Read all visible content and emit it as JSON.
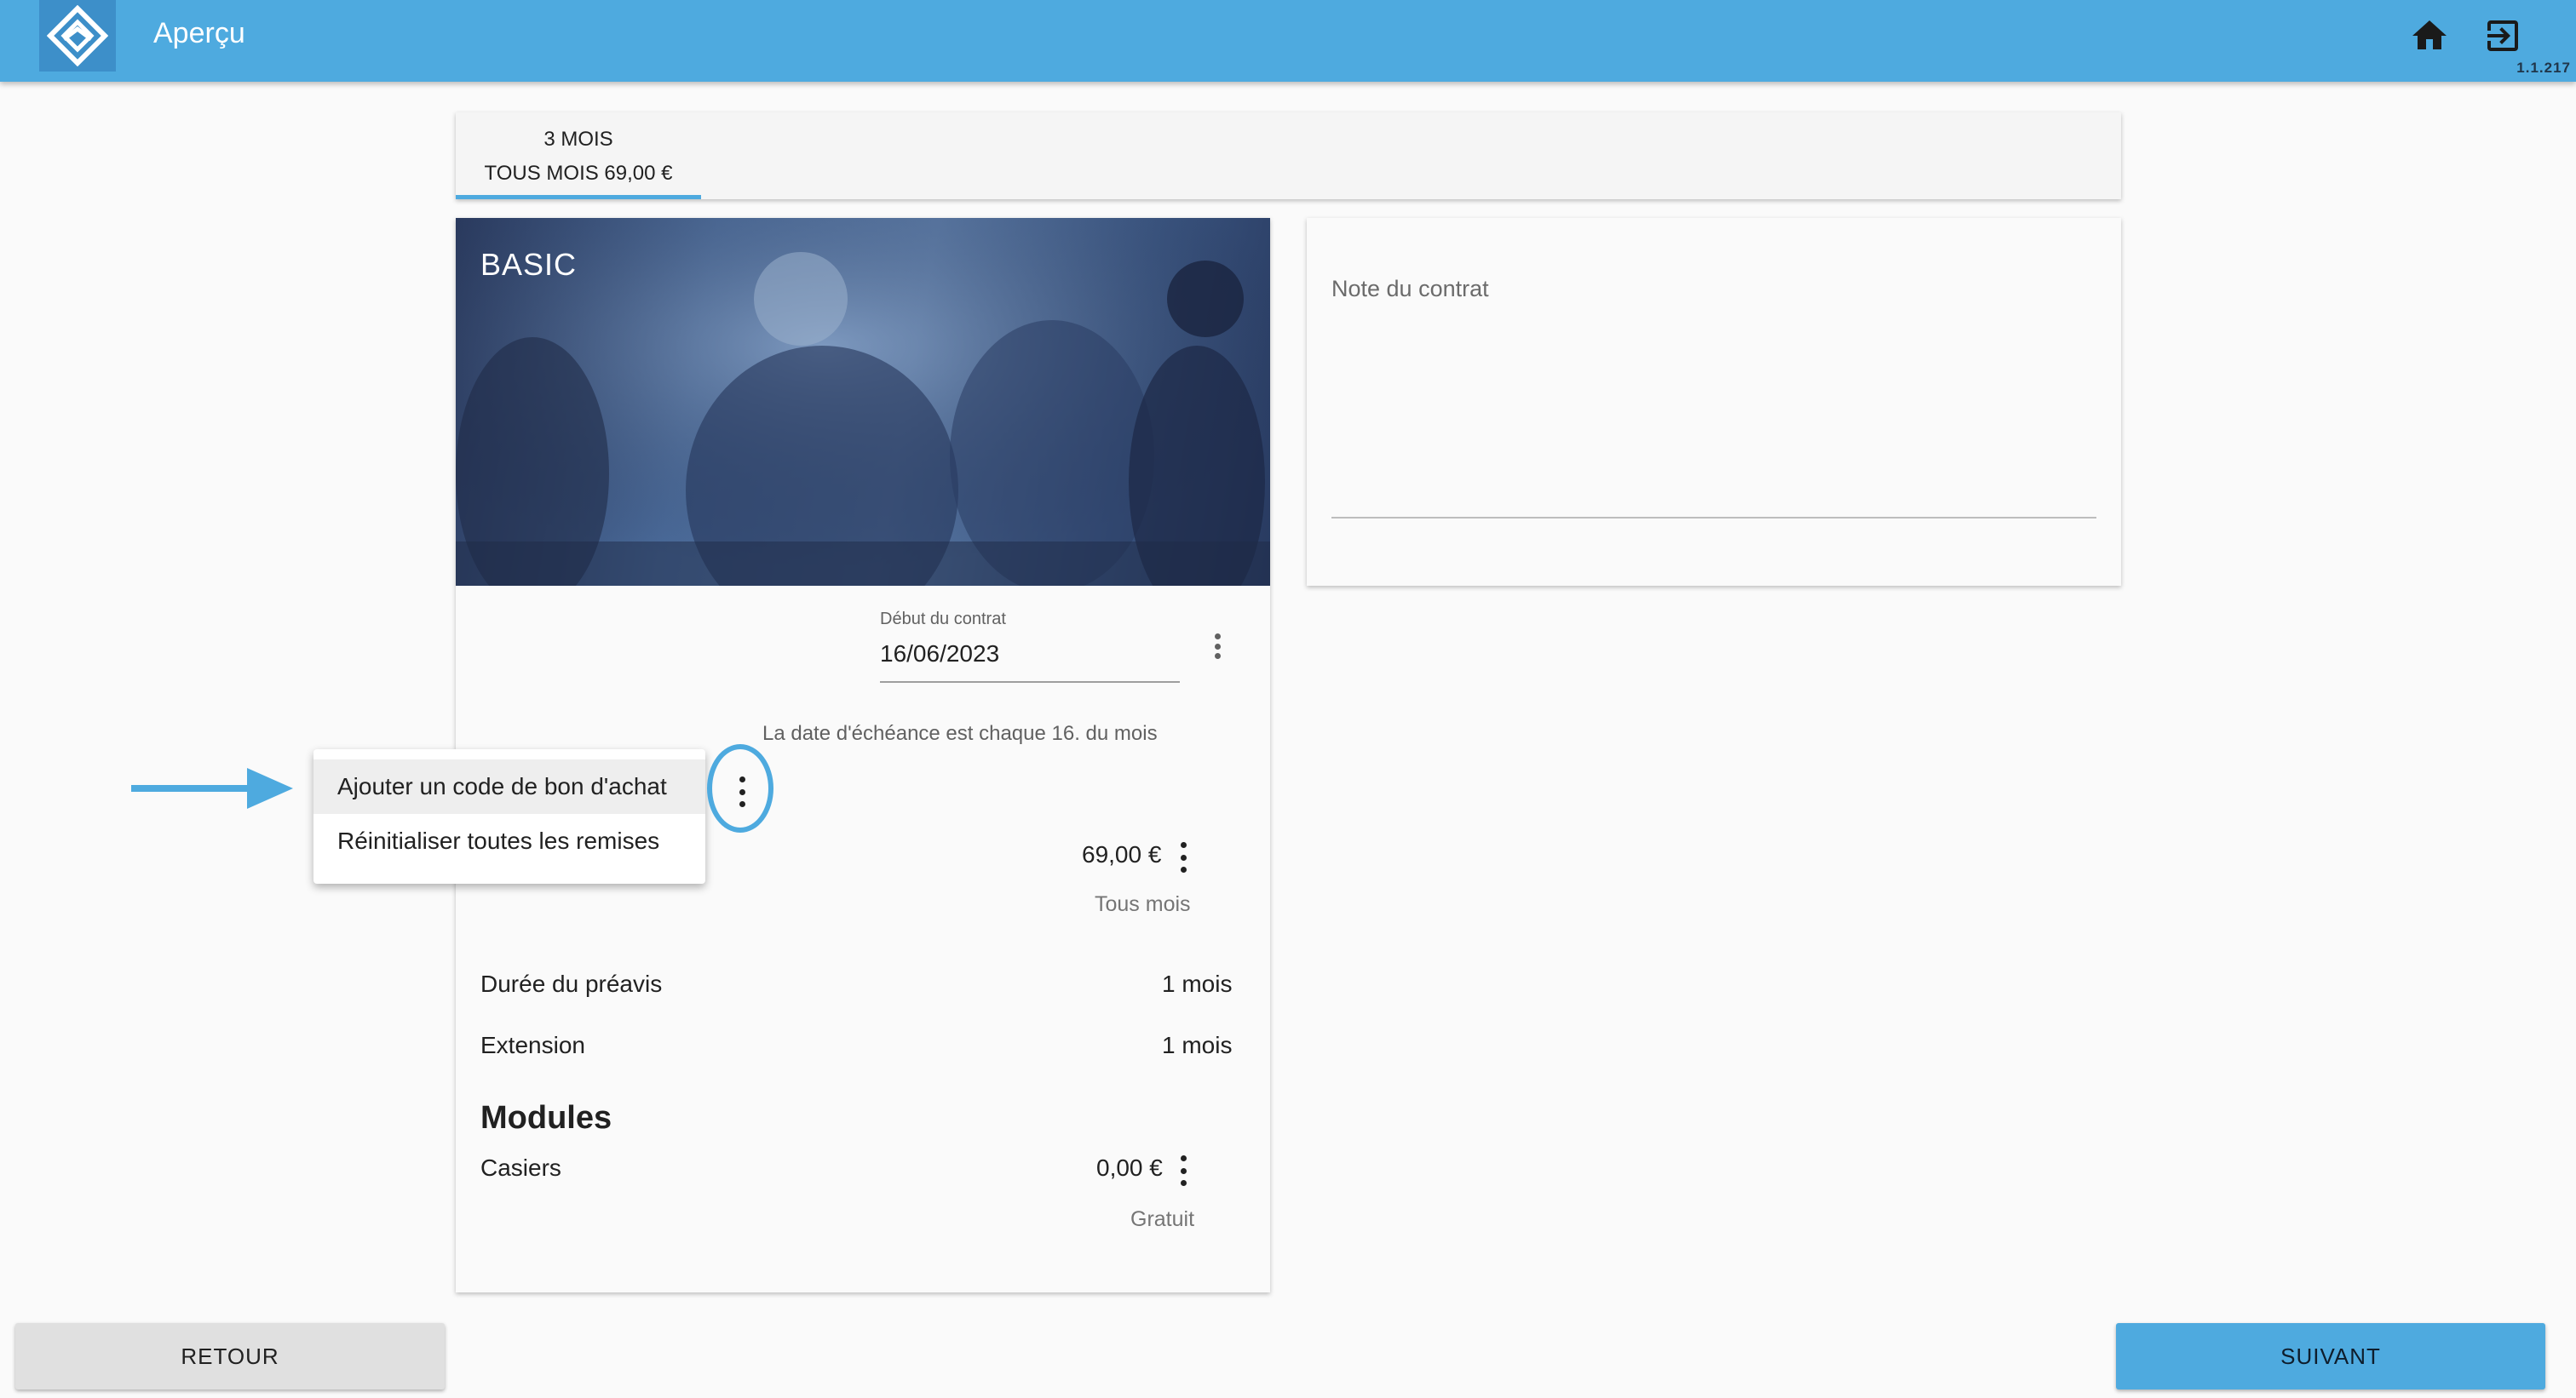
{
  "header": {
    "title": "Aperçu",
    "version": "1.1.217",
    "home_icon": "home-icon",
    "logout_icon": "logout-icon",
    "logo_icon": "diamond-logo-icon",
    "color": "#4eaadf"
  },
  "tabs": [
    {
      "line1": "3 MOIS",
      "line2": "TOUS MOIS 69,00 €",
      "active": true
    }
  ],
  "offer": {
    "title": "BASIC",
    "start_label": "Début du contrat",
    "start_value": "16/06/2023",
    "due_text": "La date d'échéance est chaque 16. du mois",
    "price": "69,00 €",
    "price_period": "Tous mois",
    "notice_label": "Durée du préavis",
    "notice_value": "1 mois",
    "extension_label": "Extension",
    "extension_value": "1 mois",
    "modules_heading": "Modules",
    "module_name": "Casiers",
    "module_price": "0,00 €",
    "module_note": "Gratuit"
  },
  "context_menu": {
    "items": [
      "Ajouter un code de bon d'achat",
      "Réinitialiser toutes les remises"
    ]
  },
  "note": {
    "label": "Note du contrat"
  },
  "footer": {
    "back_label": "RETOUR",
    "next_label": "SUIVANT"
  }
}
